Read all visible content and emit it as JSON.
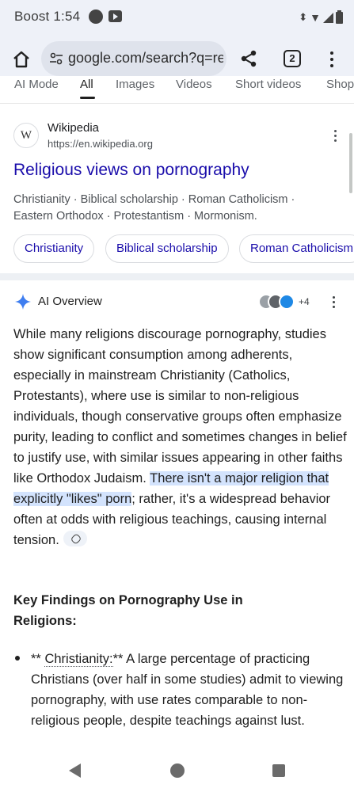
{
  "status": {
    "carrier_time": "Boost 1:54"
  },
  "browser": {
    "url": "google.com/search?q=re",
    "tab_count": "2"
  },
  "search_tabs": [
    "AI Mode",
    "All",
    "Images",
    "Videos",
    "Short videos",
    "Shopping"
  ],
  "result": {
    "site_icon_letter": "W",
    "site_name": "Wikipedia",
    "site_url": "https://en.wikipedia.org",
    "title": "Religious views on pornography",
    "snippet_line1": "Christianity · Biblical scholarship · Roman Catholicism ·",
    "snippet_line2": "Eastern Orthodox · Protestantism · Mormonism.",
    "chips": [
      "Christianity",
      "Biblical scholarship",
      "Roman Catholicism"
    ]
  },
  "ai_overview": {
    "title": "AI Overview",
    "source_count": "+4",
    "paragraph_before": "While many religions discourage pornography, studies show significant consumption among adherents, especially in mainstream Christianity (Catholics, Protestants), where use is similar to non-religious individuals, though conservative groups often emphasize purity, leading to conflict and sometimes changes in belief to justify use, with similar issues appearing in other faiths like Orthodox Judaism. ",
    "paragraph_highlight": "There isn't a major religion that explicitly \"likes\" porn",
    "paragraph_after": "; rather, it's a widespread behavior often at odds with religious teachings, causing internal tension.",
    "heading": "Key Findings on Pornography Use in Religions:",
    "bullet_prefix": "** ",
    "bullet_term": "Christianity:",
    "bullet_body": "** A large percentage of practicing Christians (over half in some studies) admit to viewing pornography, with use rates comparable to non-religious people, despite teachings against lust."
  }
}
